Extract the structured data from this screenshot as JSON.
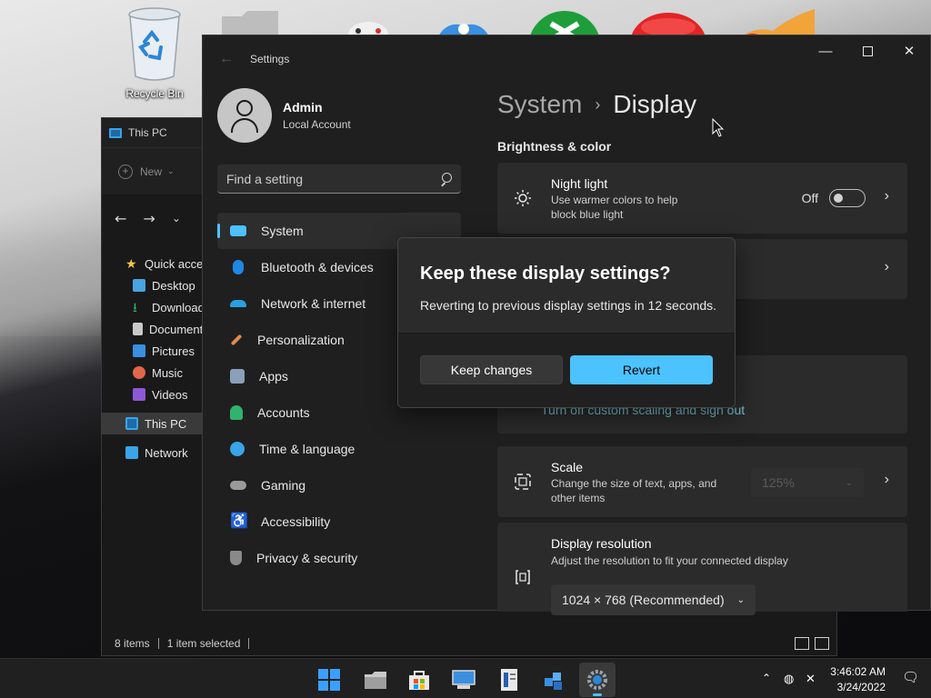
{
  "desktop": {
    "recycle_bin_label": "Recycle Bin"
  },
  "explorer": {
    "title": "This PC",
    "new_label": "New",
    "nav": [
      {
        "label": "Quick access",
        "color": "#f4c542"
      },
      {
        "label": "Desktop",
        "color": "#4aa3df"
      },
      {
        "label": "Downloads",
        "color": "#2fb36d"
      },
      {
        "label": "Documents",
        "color": "#c9c9c9"
      },
      {
        "label": "Pictures",
        "color": "#3a8fe0"
      },
      {
        "label": "Music",
        "color": "#e2664a"
      },
      {
        "label": "Videos",
        "color": "#8e57d6"
      },
      {
        "label": "This PC",
        "color": "#3aa4e8"
      },
      {
        "label": "Network",
        "color": "#3aa4e8"
      }
    ],
    "status": {
      "items": "8 items",
      "selected": "1 item selected"
    }
  },
  "settings": {
    "window_title": "Settings",
    "user": {
      "name": "Admin",
      "type": "Local Account"
    },
    "search": {
      "placeholder": "Find a setting"
    },
    "nav": [
      {
        "label": "System",
        "icon": "system-icon",
        "color": "#4cc2ff",
        "active": true
      },
      {
        "label": "Bluetooth & devices",
        "icon": "bluetooth-icon",
        "color": "#1e88e5"
      },
      {
        "label": "Network & internet",
        "icon": "wifi-icon",
        "color": "#2aa0e0"
      },
      {
        "label": "Personalization",
        "icon": "brush-icon",
        "color": "#e0884a"
      },
      {
        "label": "Apps",
        "icon": "apps-icon",
        "color": "#8aa0b8"
      },
      {
        "label": "Accounts",
        "icon": "person-icon",
        "color": "#2fb36d"
      },
      {
        "label": "Time & language",
        "icon": "globe-clock-icon",
        "color": "#3aa4e8"
      },
      {
        "label": "Gaming",
        "icon": "controller-icon",
        "color": "#9a9a9a"
      },
      {
        "label": "Accessibility",
        "icon": "accessibility-icon",
        "color": "#3aa4e8"
      },
      {
        "label": "Privacy & security",
        "icon": "shield-icon",
        "color": "#8a8a8a"
      }
    ],
    "breadcrumb": {
      "parent": "System",
      "separator": "›",
      "current": "Display"
    },
    "section_title": "Brightness & color",
    "night_light": {
      "title": "Night light",
      "subtitle_line1": "Use warmer colors to help",
      "subtitle_line2": "block blue light",
      "state_label": "Off"
    },
    "scaling_link": "Turn off custom scaling and sign out",
    "scale": {
      "title": "Scale",
      "subtitle_line1": "Change the size of text, apps, and",
      "subtitle_line2": "other items",
      "value": "125%"
    },
    "resolution": {
      "title": "Display resolution",
      "subtitle": "Adjust the resolution to fit your connected display",
      "value": "1024 × 768 (Recommended)"
    }
  },
  "dialog": {
    "title": "Keep these display settings?",
    "message": "Reverting to previous display settings in 12 seconds.",
    "keep_label": "Keep changes",
    "revert_label": "Revert"
  },
  "taskbar": {
    "time": "3:46:02 AM",
    "date": "3/24/2022",
    "accent": "#4cc2ff"
  }
}
